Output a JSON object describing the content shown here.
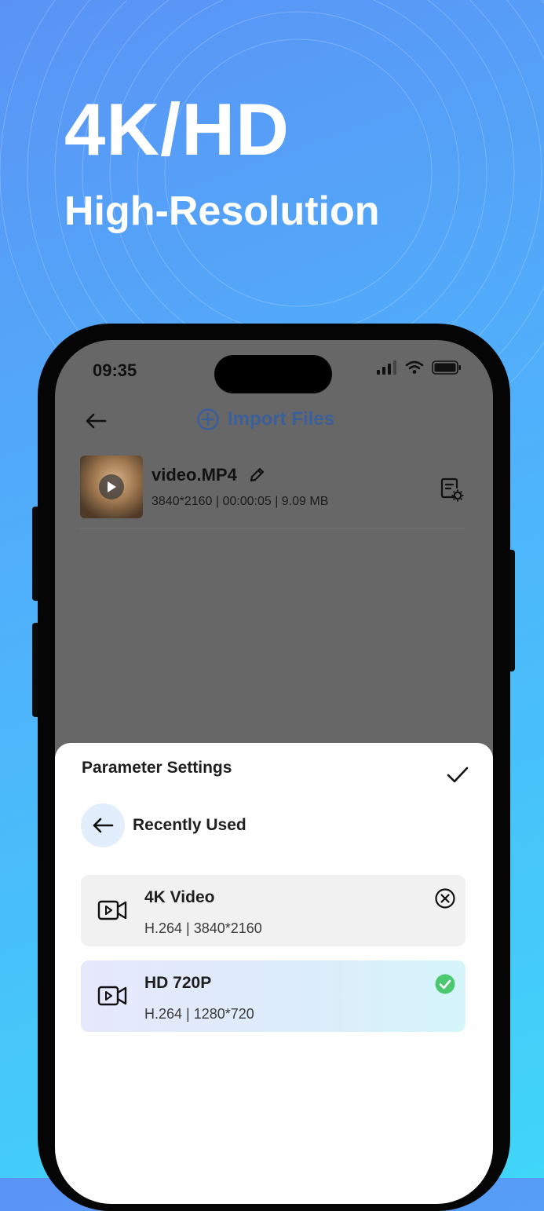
{
  "promo": {
    "headline": "4K/HD",
    "subline": "High-Resolution"
  },
  "status_bar": {
    "time": "09:35"
  },
  "nav": {
    "back_icon": "arrow-left-icon",
    "import_icon": "plus-circle-icon",
    "import_label": "Import Files"
  },
  "file": {
    "name": "video.MP4",
    "meta": "3840*2160  |  00:00:05  |  9.09 MB",
    "edit_icon": "pencil-icon",
    "settings_icon": "document-gear-icon"
  },
  "sheet": {
    "title": "Parameter Settings",
    "confirm_icon": "checkmark-icon",
    "recent_label": "Recently Used",
    "presets": [
      {
        "name": "4K Video",
        "spec": "H.264  |  3840*2160",
        "action_icon": "close-circle-icon",
        "selected": false
      },
      {
        "name": "HD 720P",
        "spec": "H.264  |  1280*720",
        "action_icon": "check-circle-icon",
        "selected": true
      }
    ]
  },
  "colors": {
    "background_top": "#5a93f5",
    "background_bottom": "#3fd6f8",
    "import_accent": "#3a5f9a",
    "selected_check": "#4cc86f"
  }
}
